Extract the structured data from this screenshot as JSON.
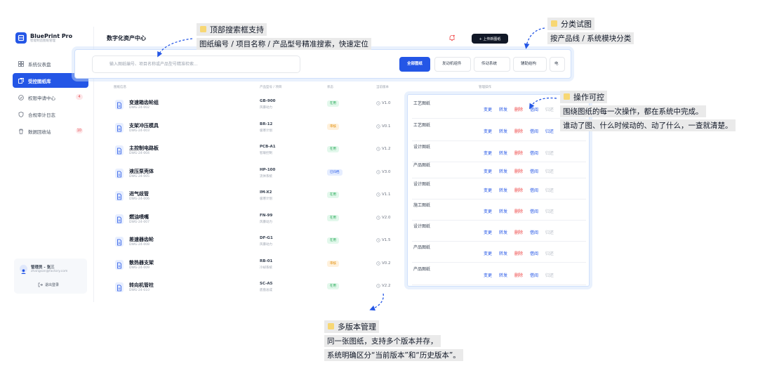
{
  "brand": {
    "name": "BluePrint Pro",
    "subtitle": "智能制造图纸管理"
  },
  "nav": [
    {
      "label": "系统仪表盘",
      "icon": "dashboard-icon",
      "active": false,
      "badge": ""
    },
    {
      "label": "受控图纸库",
      "icon": "library-icon",
      "active": true,
      "badge": ""
    },
    {
      "label": "权限申请中心",
      "icon": "check-circle-icon",
      "active": false,
      "badge": "4"
    },
    {
      "label": "合规审计日志",
      "icon": "shield-icon",
      "active": false,
      "badge": ""
    },
    {
      "label": "数据回收站",
      "icon": "trash-icon",
      "active": false,
      "badge": "10"
    }
  ],
  "user": {
    "name": "管理员 - 张三",
    "email": "zhangsan@factory.com",
    "logout": "退出登录"
  },
  "header": {
    "title": "数字化资产中心",
    "upload": "+ 上传新图纸"
  },
  "search": {
    "placeholder": "输入图纸编号、项目名称或产品型号精准检索..."
  },
  "categories": [
    "全部图纸",
    "发动机组件",
    "传动系统",
    "辅助结构",
    "电"
  ],
  "table": {
    "headers": {
      "info": "图纸信息",
      "model": "产品型号 / 项目",
      "status": "状态",
      "version": "当前版本",
      "ops": "管理操作"
    },
    "rows": [
      {
        "name": "变速箱齿轮组",
        "code": "DWG-24-002",
        "model": "GB-900",
        "project": "风暴动力",
        "status": "在用",
        "status_type": "green",
        "version": "V1.0"
      },
      {
        "name": "支架冲压模具",
        "code": "DWG-24-003",
        "model": "BR-12",
        "project": "极寒计划",
        "status": "审核",
        "status_type": "orange",
        "version": "V0.1"
      },
      {
        "name": "主控制电路板",
        "code": "DWG-24-004",
        "model": "PCB-A1",
        "project": "智联控制",
        "status": "在用",
        "status_type": "green",
        "version": "V1.2"
      },
      {
        "name": "液压泵壳体",
        "code": "DWG-24-005",
        "model": "HP-100",
        "project": "流体系统",
        "status": "已归档",
        "status_type": "blue",
        "version": "V3.0"
      },
      {
        "name": "进气歧管",
        "code": "DWG-24-006",
        "model": "IM-X2",
        "project": "极寒计划",
        "status": "在用",
        "status_type": "green",
        "version": "V1.1"
      },
      {
        "name": "燃油喷嘴",
        "code": "DWG-24-007",
        "model": "FN-99",
        "project": "风暴动力",
        "status": "在用",
        "status_type": "green",
        "version": "V2.0"
      },
      {
        "name": "差速器齿轮",
        "code": "DWG-24-008",
        "model": "DF-G1",
        "project": "风暴动力",
        "status": "在用",
        "status_type": "green",
        "version": "V1.5"
      },
      {
        "name": "散热器支架",
        "code": "DWG-24-009",
        "model": "RB-01",
        "project": "冷却系统",
        "status": "审核",
        "status_type": "orange",
        "version": "V0.2"
      },
      {
        "name": "转向机管柱",
        "code": "DWG-24-010",
        "model": "SC-A5",
        "project": "底盘总成",
        "status": "在用",
        "status_type": "green",
        "version": "V2.2"
      }
    ]
  },
  "ops": {
    "rows": [
      {
        "type": "工艺图纸",
        "actions": [
          "变更",
          "转发",
          "删除",
          "借阅",
          "归还"
        ],
        "styles": [
          "blue",
          "blue",
          "red",
          "blue",
          "gray"
        ]
      },
      {
        "type": "工艺图纸",
        "actions": [
          "变更",
          "转发",
          "删除",
          "借阅",
          "归还"
        ],
        "styles": [
          "blue",
          "blue",
          "red",
          "blue",
          "blue"
        ]
      },
      {
        "type": "设计图纸",
        "actions": [
          "变更",
          "转发",
          "删除",
          "借阅",
          "归还"
        ],
        "styles": [
          "blue",
          "blue",
          "red",
          "blue",
          "gray"
        ]
      },
      {
        "type": "产品图纸",
        "actions": [
          "变更",
          "转发",
          "删除",
          "借阅",
          "归还"
        ],
        "styles": [
          "blue",
          "blue",
          "red",
          "blue",
          "gray"
        ]
      },
      {
        "type": "设计图纸",
        "actions": [
          "变更",
          "转发",
          "删除",
          "借阅",
          "归还"
        ],
        "styles": [
          "blue",
          "blue",
          "red",
          "blue",
          "gray"
        ]
      },
      {
        "type": "施工图纸",
        "actions": [
          "变更",
          "转发",
          "删除",
          "借阅",
          "归还"
        ],
        "styles": [
          "blue",
          "blue",
          "red",
          "blue",
          "gray"
        ]
      },
      {
        "type": "设计图纸",
        "actions": [
          "变更",
          "转发",
          "删除",
          "借阅",
          "归还"
        ],
        "styles": [
          "blue",
          "blue",
          "red",
          "blue",
          "gray"
        ]
      },
      {
        "type": "产品图纸",
        "actions": [
          "变更",
          "转发",
          "删除",
          "借阅",
          "归还"
        ],
        "styles": [
          "blue",
          "blue",
          "red",
          "blue",
          "gray"
        ]
      },
      {
        "type": "产品图纸",
        "actions": [
          "变更",
          "转发",
          "删除",
          "借阅",
          "归还"
        ],
        "styles": [
          "blue",
          "blue",
          "red",
          "blue",
          "gray"
        ]
      }
    ]
  },
  "callouts": {
    "search": {
      "title": "顶部搜索框支持",
      "lines": [
        "图纸编号 / 项目名称 / 产品型号精准搜索，快速定位"
      ]
    },
    "category": {
      "title": "分类试图",
      "lines": [
        "按产品线 / 系统模块分类"
      ]
    },
    "ops": {
      "title": "操作可控",
      "lines": [
        "围绕图纸的每一次操作，都在系统中完成。",
        "谁动了图、什么时候动的、动了什么，一查就清楚。"
      ]
    },
    "version": {
      "title": "多版本管理",
      "lines": [
        "同一张图纸，支持多个版本并存，",
        "系统明确区分“当前版本”和“历史版本”。"
      ]
    }
  },
  "colors": {
    "accent": "#2456e6",
    "danger": "#ef4444",
    "success": "#16a34a",
    "warning": "#e08a00",
    "callout_bg": "#eaeaea"
  }
}
